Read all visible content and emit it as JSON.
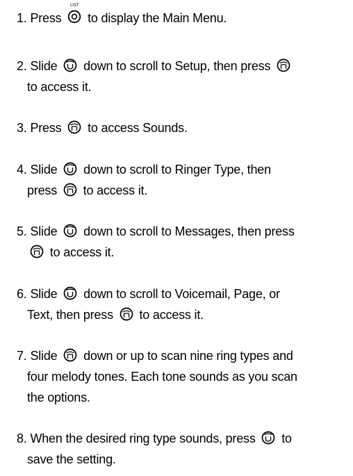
{
  "icons": {
    "list_key_caption": "LIST",
    "list_key": "list-key-icon",
    "nav_slide": "navigation-key-slide-icon",
    "nav_press": "navigation-key-press-icon"
  },
  "steps": [
    {
      "number": "1.",
      "text": [
        "Press",
        "to display the Main Menu."
      ]
    },
    {
      "number": "2.",
      "text": [
        "Slide",
        "down to scroll to Setup, then press",
        "to access it."
      ]
    },
    {
      "number": "3.",
      "text": [
        "Press",
        "to access Sounds."
      ]
    },
    {
      "number": "4.",
      "text": [
        "Slide",
        "down to scroll to Ringer Type, then",
        "press",
        "to access it."
      ]
    },
    {
      "number": "5.",
      "text": [
        "Slide",
        "down to scroll to Messages, then press",
        "to access it."
      ]
    },
    {
      "number": "6.",
      "text": [
        "Slide",
        "down to scroll to Voicemail, Page, or",
        "Text, then press",
        "to access it."
      ]
    },
    {
      "number": "7.",
      "text": [
        "Slide",
        "down or up to scan nine ring types and",
        "four melody tones. Each tone sounds as you scan",
        "the options."
      ]
    },
    {
      "number": "8.",
      "text": [
        "When the desired ring type sounds, press",
        "to",
        "save the setting."
      ]
    }
  ]
}
